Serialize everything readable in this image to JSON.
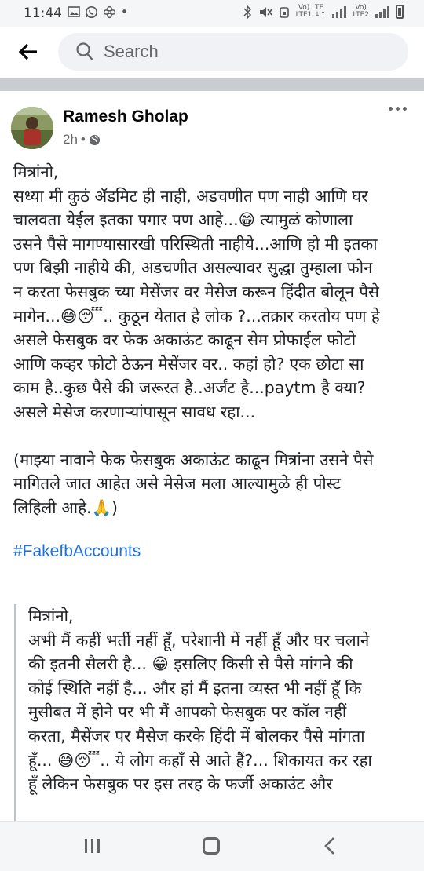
{
  "status_bar": {
    "time": "11:44",
    "lte1": "Vo) LTE\nLTE1",
    "lte2": "Vo)\nLTE2"
  },
  "search": {
    "placeholder": "Search"
  },
  "post": {
    "author": "Ramesh Gholap",
    "time_ago": "2h",
    "separator": "•",
    "body_lines": [
      "मित्रांनो,",
      "सध्या मी कुठं ॲडमिट ही नाही, अडचणीत पण नाही आणि घर",
      "चालवता येईल इतका पगार पण आहे...😁 त्यामुळं कोणाला",
      "उसने पैसे मागण्यासारखी परिस्थिती नाहीये...आणि हो मी इतका",
      "पण बिझी नाहीये की, अडचणीत असल्यावर सुद्धा तुम्हाला फोन",
      "न करता फेसबुक च्या मेसेंजर वर मेसेज करून हिंदीत बोलून पैसे",
      "मागेन...😅😴.. कुठून येतात हे लोक ?...तक्रार करतोय पण हे",
      "असले फेसबुक वर फेक अकाऊंट काढून सेम  प्रोफाईल फोटो",
      "आणि कव्हर फोटो ठेऊन मेसेंजर वर.. कहां हो? एक छोटा सा",
      "काम है..कुछ पैसे की जरूरत है..अर्जंट है...paytm है क्या?",
      "असले मेसेज करणाऱ्यांपासून सावध रहा..."
    ],
    "note_lines": [
      "(माझ्या नावाने फेक फेसबुक अकाऊंट काढून मित्रांना उसने पैसे",
      "मागितले जात आहेत असे मेसेज मला आल्यामुळे ही पोस्ट",
      "लिहिली आहे.🙏)"
    ],
    "hashtag": "#FakefbAccounts",
    "translation_lines": [
      "मित्रांनो,",
      "अभी मैं कहीं भर्ती नहीं हूँ, परेशानी में नहीं हूँ और घर चलाने",
      "की इतनी सैलरी है... 😁 इसलिए किसी से पैसे मांगने की",
      "कोई स्थिति नहीं है... और हां मैं इतना व्यस्त भी नहीं हूँ कि",
      "मुसीबत में होने पर भी मैं आपको फेसबुक पर कॉल नहीं",
      "करता, मैसेंजर पर मैसेज करके हिंदी में बोलकर पैसे मांगता",
      "हूँ... 😅😴.. ये लोग कहाँ से आते हैं?... शिकायत कर रहा",
      "हूँ लेकिन फेसबुक पर इस तरह के फर्जी अकाउंट और"
    ]
  },
  "colors": {
    "link": "#216fdb",
    "divider": "#c9ccd1"
  },
  "icons": [
    "image-icon",
    "whatsapp-icon",
    "pinwheel-icon",
    "bluetooth-icon",
    "mute-icon",
    "alarm-icon",
    "signal-icon",
    "battery-icon",
    "back-arrow-icon",
    "search-icon",
    "globe-icon",
    "more-icon",
    "recent-apps-icon",
    "home-icon",
    "nav-back-icon"
  ]
}
